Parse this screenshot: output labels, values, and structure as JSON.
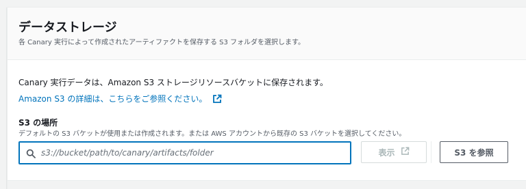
{
  "section": {
    "title": "データストレージ",
    "description": "各 Canary 実行によって作成されたアーティファクトを保存する S3 フォルダを選択します。"
  },
  "info": {
    "text": "Canary 実行データは、Amazon S3 ストレージリソースバケットに保存されます。",
    "link_text": "Amazon S3 の詳細は、こちらをご参照ください。",
    "link_icon": "external-link-icon"
  },
  "field": {
    "label": "S3 の場所",
    "description": "デフォルトの S3 バケットが使用または作成されます。または AWS アカウントから既存の S3 バケットを選択してください。",
    "placeholder": "s3://bucket/path/to/canary/artifacts/folder",
    "value": ""
  },
  "buttons": {
    "view_label": "表示",
    "browse_label": "S3 を参照"
  },
  "colors": {
    "link": "#0073bb",
    "focus_border": "#0073bb",
    "disabled_text": "#aab7b8"
  }
}
